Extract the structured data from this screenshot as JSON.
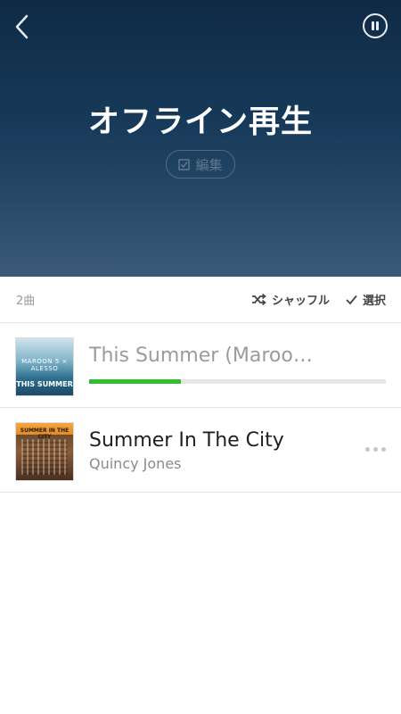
{
  "header": {
    "title": "オフライン再生",
    "edit_label": "編集"
  },
  "toolbar": {
    "count": "2曲",
    "shuffle_label": "シャッフル",
    "select_label": "選択"
  },
  "tracks": [
    {
      "title": "This Summer (Maroon…",
      "artist": "",
      "art_text_top": "MAROON 5 × ALESSO",
      "art_text_bottom": "THIS SUMMER",
      "download_progress": 0.31,
      "state": "downloading"
    },
    {
      "title": "Summer In The City",
      "artist": "Quincy Jones",
      "art_text_top": "SUMMER IN THE CITY",
      "state": "ready"
    }
  ],
  "colors": {
    "header_top": "#0f2a45",
    "header_bottom": "#3a5a78",
    "progress": "#2ec02e"
  },
  "icons": [
    "back-arrow-icon",
    "pause-icon",
    "edit-checkbox-icon",
    "shuffle-icon",
    "checkmark-icon",
    "more-dots-icon"
  ]
}
